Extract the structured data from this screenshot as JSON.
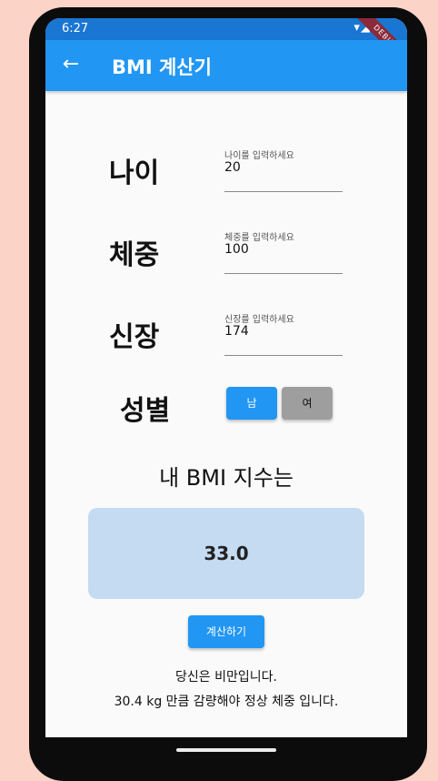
{
  "status": {
    "time": "6:27",
    "icons": "▾◢▮",
    "debug_label": "DEBUG"
  },
  "appbar": {
    "back_icon": "←",
    "title": "BMI 계산기"
  },
  "form": {
    "age": {
      "label": "나이",
      "placeholder": "나이를 입력하세요",
      "value": "20"
    },
    "weight": {
      "label": "체중",
      "placeholder": "체중를 입력하세요",
      "value": "100"
    },
    "height": {
      "label": "신장",
      "placeholder": "신장를 입력하세요",
      "value": "174"
    },
    "gender": {
      "label": "성별",
      "male": "남",
      "female": "여"
    }
  },
  "result": {
    "title": "내 BMI 지수는",
    "value": "33.0"
  },
  "calc_button": "계산하기",
  "messages": {
    "status": "당신은 비만입니다.",
    "advice": "30.4 kg 만큼 감량해야 정상 체중 입니다."
  },
  "colors": {
    "appbar": "#2196f3",
    "statusbar": "#1976d2",
    "result_box": "#c4dbf2",
    "male_selected": "#2196f3",
    "female_unselected": "#9e9e9e"
  }
}
